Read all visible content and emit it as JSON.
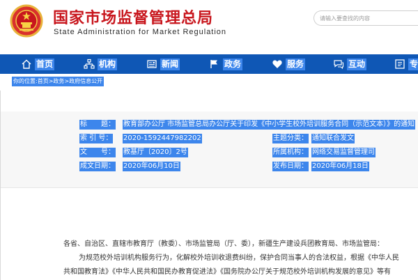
{
  "header": {
    "title": "国家市场监督管理总局",
    "subtitle": "State Administration for Market Regulation",
    "search_placeholder": "请输入要查找的内容"
  },
  "nav": {
    "items": [
      {
        "label": "首页",
        "icon": "home-icon"
      },
      {
        "label": "机构",
        "icon": "sitemap-icon"
      },
      {
        "label": "新闻",
        "icon": "newspaper-icon"
      },
      {
        "label": "政务",
        "icon": "flag-icon"
      },
      {
        "label": "服务",
        "icon": "heart-icon"
      },
      {
        "label": "互动",
        "icon": "chat-icon"
      },
      {
        "label": "专",
        "icon": "topic-icon"
      }
    ]
  },
  "breadcrumb": "你的位置:首页>政务>政府信息公开",
  "meta": {
    "title_label": "标　　题：",
    "title_value": "教育部办公厅 市场监管总局办公厅关于印发《中小学生校外培训服务合同（示范文本）》的通知",
    "index_label": "索 引 号：",
    "index_value": "2020-1592447982202",
    "category_label": "主题分类：",
    "category_value": "通知联合发文",
    "doc_no_label": "文　　号：",
    "doc_no_value": "教基厅〔2020〕2号",
    "agency_label": "所属机构：",
    "agency_value": "网络交易监督管理司",
    "created_label": "成文日期：",
    "created_value": "2020年06月10日",
    "published_label": "发布日期：",
    "published_value": "2020年06月18日"
  },
  "body": {
    "salutation": "各省、自治区、直辖市教育厅（教委）、市场监管局（厅、委），新疆生产建设兵团教育局、市场监管局：",
    "line1": "为规范校外培训机构服务行为，化解校外培训收退费纠纷，保护合同当事人的合法权益，根据《中华人民",
    "line2": "共和国教育法》《中华人民共和国民办教育促进法》《国务院办公厅关于规范校外培训机构发展的意见》等有"
  },
  "colors": {
    "brand_red": "#c8161d",
    "nav_blue": "#0f57b5",
    "selection_blue": "#3d86ec"
  }
}
